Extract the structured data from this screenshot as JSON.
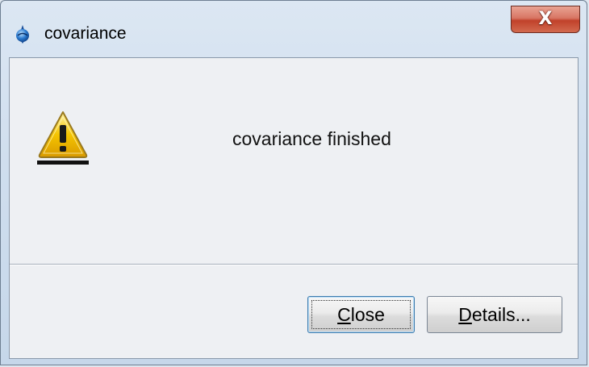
{
  "window": {
    "title": "covariance",
    "close_glyph": "X"
  },
  "dialog": {
    "message": "covariance finished",
    "icon": "warning-icon"
  },
  "buttons": {
    "close": {
      "mnemonic": "C",
      "rest": "lose"
    },
    "details": {
      "mnemonic": "D",
      "rest": "etails..."
    }
  },
  "colors": {
    "titlebar": "#cfdeee",
    "client_bg": "#eef0f3",
    "close_button": "#c1412a",
    "warning_yellow": "#f5c400",
    "default_button_border": "#3d7bad"
  }
}
